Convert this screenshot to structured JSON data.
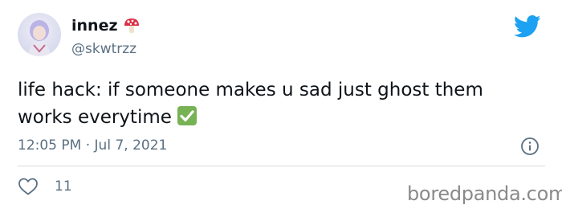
{
  "tweet": {
    "display_name": "innez",
    "name_emoji": "mushroom-icon",
    "handle": "@skwtrzz",
    "text_line_1": "life hack: if someone makes u sad just ghost them",
    "text_line_2": "works everytime",
    "text_emoji": "check-mark-button-icon",
    "timestamp": "12:05 PM · Jul 7, 2021",
    "likes": "11"
  },
  "icons": {
    "brand": "twitter-bird-icon",
    "info": "info-icon",
    "like": "heart-icon"
  },
  "colors": {
    "twitter_blue": "#1da1f2",
    "secondary_text": "#5b7083",
    "check_green": "#77b255",
    "mushroom_red": "#dd2e44"
  },
  "watermark": "boredpanda.com"
}
